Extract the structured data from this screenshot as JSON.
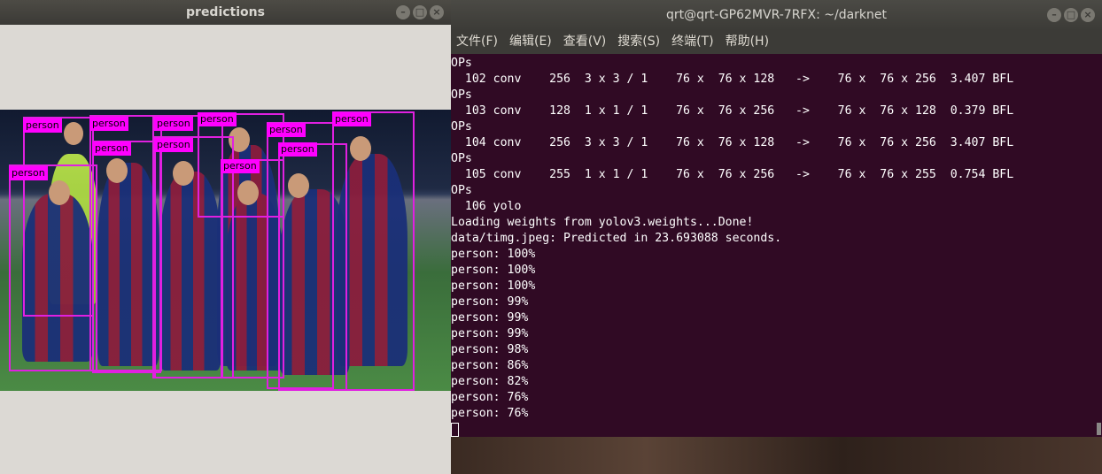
{
  "predictions_window": {
    "title": "predictions",
    "detections": [
      {
        "label": "person"
      },
      {
        "label": "person"
      },
      {
        "label": "person"
      },
      {
        "label": "person"
      },
      {
        "label": "person"
      },
      {
        "label": "person"
      },
      {
        "label": "person"
      },
      {
        "label": "person"
      },
      {
        "label": "person"
      },
      {
        "label": "person"
      },
      {
        "label": "person"
      }
    ]
  },
  "terminal_window": {
    "title": "qrt@qrt-GP62MVR-7RFX: ~/darknet",
    "menu": [
      "文件(F)",
      "编辑(E)",
      "查看(V)",
      "搜索(S)",
      "终端(T)",
      "帮助(H)"
    ],
    "lines": [
      "OPs",
      "  102 conv    256  3 x 3 / 1    76 x  76 x 128   ->    76 x  76 x 256  3.407 BFL",
      "OPs",
      "  103 conv    128  1 x 1 / 1    76 x  76 x 256   ->    76 x  76 x 128  0.379 BFL",
      "OPs",
      "  104 conv    256  3 x 3 / 1    76 x  76 x 128   ->    76 x  76 x 256  3.407 BFL",
      "OPs",
      "  105 conv    255  1 x 1 / 1    76 x  76 x 256   ->    76 x  76 x 255  0.754 BFL",
      "OPs",
      "  106 yolo",
      "Loading weights from yolov3.weights...Done!",
      "data/timg.jpeg: Predicted in 23.693088 seconds.",
      "person: 100%",
      "person: 100%",
      "person: 100%",
      "person: 99%",
      "person: 99%",
      "person: 99%",
      "person: 98%",
      "person: 86%",
      "person: 82%",
      "person: 76%",
      "person: 76%"
    ]
  }
}
